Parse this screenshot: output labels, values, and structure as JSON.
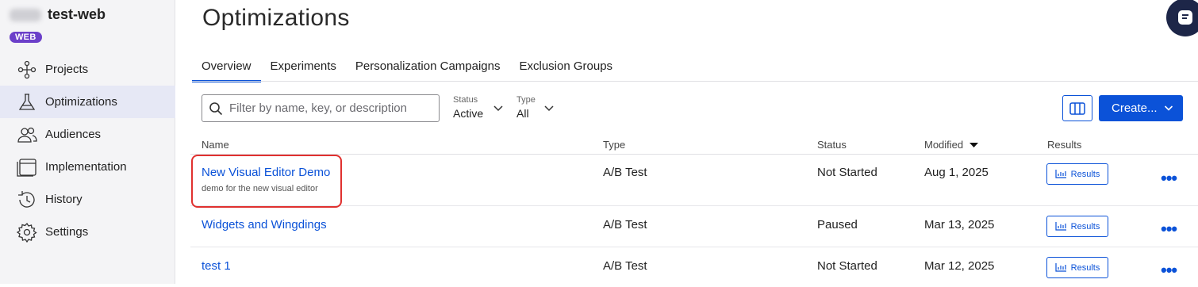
{
  "project": {
    "name": "test-web",
    "env_badge": "WEB"
  },
  "sidebar": {
    "items": [
      {
        "label": "Projects",
        "icon": "projects-icon"
      },
      {
        "label": "Optimizations",
        "icon": "flask-icon",
        "active": true
      },
      {
        "label": "Audiences",
        "icon": "audiences-icon"
      },
      {
        "label": "Implementation",
        "icon": "window-icon"
      },
      {
        "label": "History",
        "icon": "history-icon"
      },
      {
        "label": "Settings",
        "icon": "gear-icon"
      }
    ]
  },
  "main": {
    "title": "Optimizations",
    "tabs": [
      {
        "label": "Overview",
        "active": true
      },
      {
        "label": "Experiments"
      },
      {
        "label": "Personalization Campaigns"
      },
      {
        "label": "Exclusion Groups"
      }
    ],
    "search": {
      "placeholder": "Filter by name, key, or description"
    },
    "filters": {
      "status": {
        "label": "Status",
        "value": "Active"
      },
      "type": {
        "label": "Type",
        "value": "All"
      }
    },
    "create_label": "Create..."
  },
  "table": {
    "headers": {
      "name": "Name",
      "type": "Type",
      "status": "Status",
      "modified": "Modified",
      "results": "Results"
    },
    "results_button": "Results",
    "rows": [
      {
        "name": "New Visual Editor Demo",
        "description": "demo for the new visual editor",
        "type": "A/B Test",
        "status": "Not Started",
        "modified": "Aug 1, 2025"
      },
      {
        "name": "Widgets and Wingdings",
        "description": "",
        "type": "A/B Test",
        "status": "Paused",
        "modified": "Mar 13, 2025"
      },
      {
        "name": "test 1",
        "description": "",
        "type": "A/B Test",
        "status": "Not Started",
        "modified": "Mar 12, 2025"
      }
    ]
  },
  "colors": {
    "accent": "#0b52d8",
    "badge": "#6b3fc9",
    "highlight": "#e0312f",
    "help": "#1d2648"
  }
}
